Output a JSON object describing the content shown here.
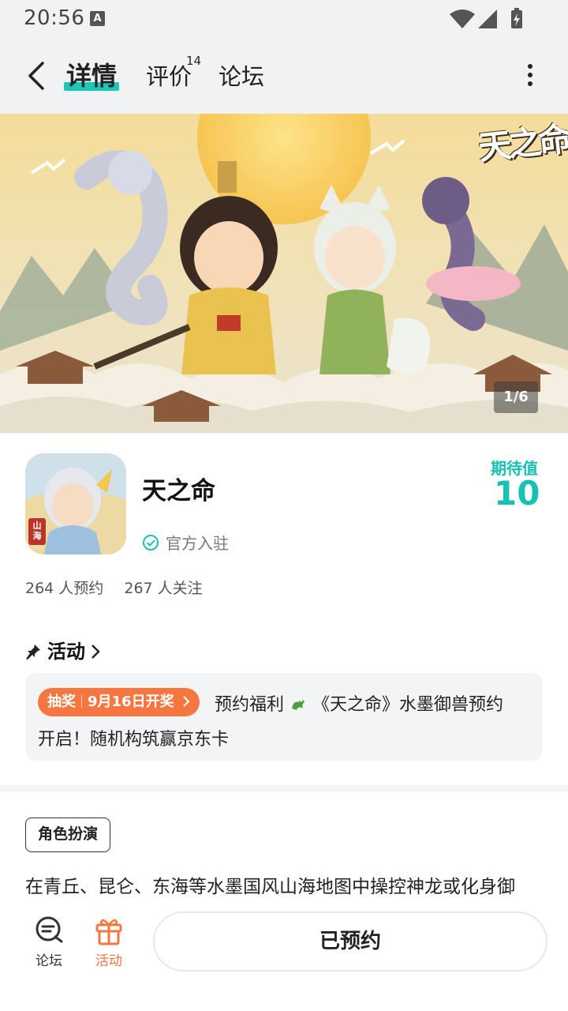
{
  "status_bar": {
    "time": "20:56",
    "notification": "A",
    "icons": [
      "wifi-icon",
      "signal-icon",
      "battery-charging-icon"
    ]
  },
  "nav": {
    "tabs": {
      "detail": "详情",
      "review": "评价",
      "review_count": "14",
      "forum": "论坛"
    },
    "active_tab": "详情"
  },
  "banner": {
    "logo_text": "天之命",
    "counter": "1/6"
  },
  "game": {
    "title": "天之命",
    "icon_caption": "山海",
    "verified_label": "官方入驻",
    "expect_label": "期待值",
    "expect_value": "10",
    "reservations": "264 人预约",
    "followers": "267 人关注"
  },
  "activity": {
    "header": "活动",
    "badge_type": "抽奖",
    "badge_date": "9月16日开奖",
    "line1": "预约福利",
    "line1_rest": "《天之命》水墨御兽预约",
    "line2": "开启！随机构筑赢京东卡"
  },
  "tags": [
    "角色扮演"
  ],
  "description": "在青丘、昆仑、东海等水墨国风山海地图中操控神龙或化身御",
  "bottom": {
    "forum_label": "论坛",
    "activity_label": "活动",
    "reserved_button": "已预约"
  },
  "colors": {
    "accent_teal": "#19c0b4",
    "accent_orange": "#f5773f",
    "background_grey": "#f1f2f3"
  }
}
